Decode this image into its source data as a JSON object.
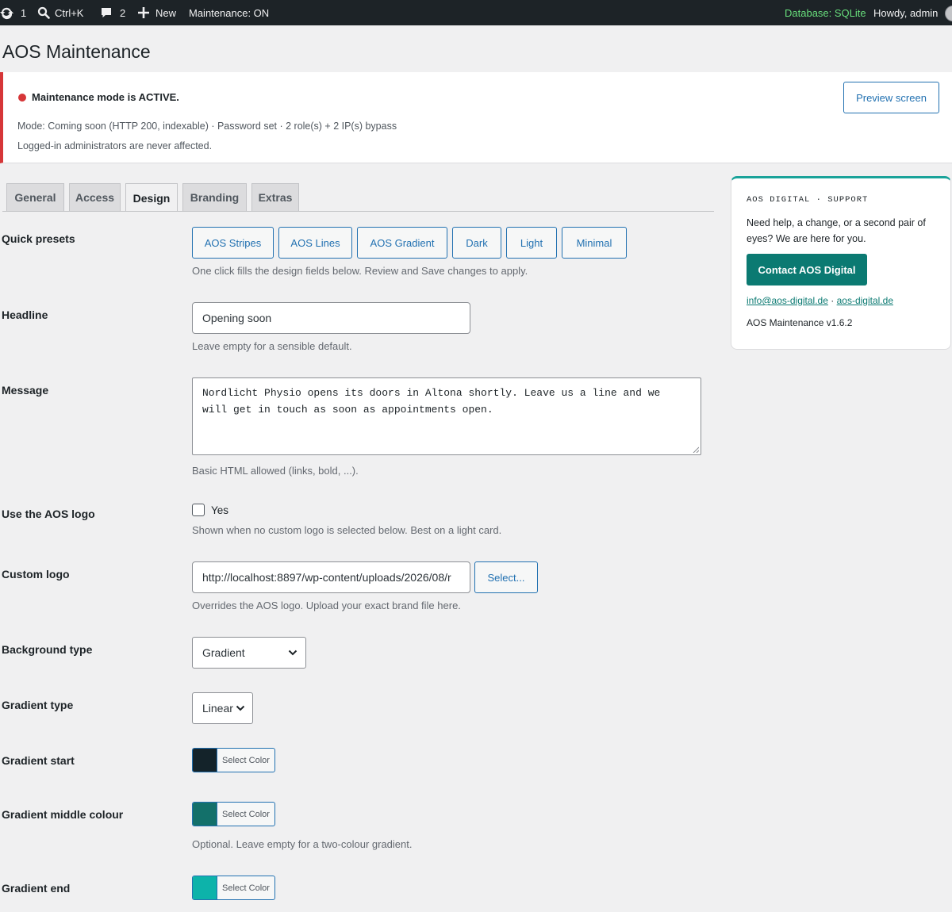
{
  "admin_bar": {
    "updates_count": "1",
    "search_shortcut": "Ctrl+K",
    "comments_count": "2",
    "new_label": "New",
    "maintenance_status": "Maintenance: ON",
    "database_label": "Database: SQLite",
    "greeting": "Howdy, admin"
  },
  "page": {
    "title": "AOS Maintenance"
  },
  "notice": {
    "status": "Maintenance mode is ACTIVE.",
    "details": "Mode: Coming soon (HTTP 200, indexable) · Password set · 2 role(s) + 2 IP(s) bypass",
    "note": "Logged-in administrators are never affected.",
    "preview_button": "Preview screen"
  },
  "tabs": [
    {
      "label": "General",
      "active": false
    },
    {
      "label": "Access",
      "active": false
    },
    {
      "label": "Design",
      "active": true
    },
    {
      "label": "Branding",
      "active": false
    },
    {
      "label": "Extras",
      "active": false
    }
  ],
  "form": {
    "quick_presets": {
      "label": "Quick presets",
      "buttons": [
        "AOS Stripes",
        "AOS Lines",
        "AOS Gradient",
        "Dark",
        "Light",
        "Minimal"
      ],
      "description": "One click fills the design fields below. Review and Save changes to apply."
    },
    "headline": {
      "label": "Headline",
      "value": "Opening soon",
      "description": "Leave empty for a sensible default."
    },
    "message": {
      "label": "Message",
      "value": "Nordlicht Physio opens its doors in Altona shortly. Leave us a line and we will get in touch as soon as appointments open.",
      "description": "Basic HTML allowed (links, bold, ...)."
    },
    "use_aos_logo": {
      "label": "Use the AOS logo",
      "checkbox_label": "Yes",
      "checked": false,
      "description": "Shown when no custom logo is selected below. Best on a light card."
    },
    "custom_logo": {
      "label": "Custom logo",
      "value": "http://localhost:8897/wp-content/uploads/2026/08/r",
      "select_button": "Select...",
      "description": "Overrides the AOS logo. Upload your exact brand file here."
    },
    "background_type": {
      "label": "Background type",
      "value": "Gradient"
    },
    "gradient_type": {
      "label": "Gradient type",
      "value": "Linear"
    },
    "gradient_start": {
      "label": "Gradient start",
      "button": "Select Color",
      "color": "#14232a"
    },
    "gradient_middle": {
      "label": "Gradient middle colour",
      "button": "Select Color",
      "color": "#13706a",
      "description": "Optional. Leave empty for a two-colour gradient."
    },
    "gradient_end": {
      "label": "Gradient end",
      "button": "Select Color",
      "color": "#0db3aa"
    }
  },
  "support": {
    "kicker": "AOS DIGITAL · SUPPORT",
    "text": "Need help, a change, or a second pair of eyes? We are here for you.",
    "contact_button": "Contact AOS Digital",
    "email_link": "info@aos-digital.de",
    "separator": "·",
    "site_link": "aos-digital.de",
    "version": "AOS Maintenance v1.6.2"
  }
}
